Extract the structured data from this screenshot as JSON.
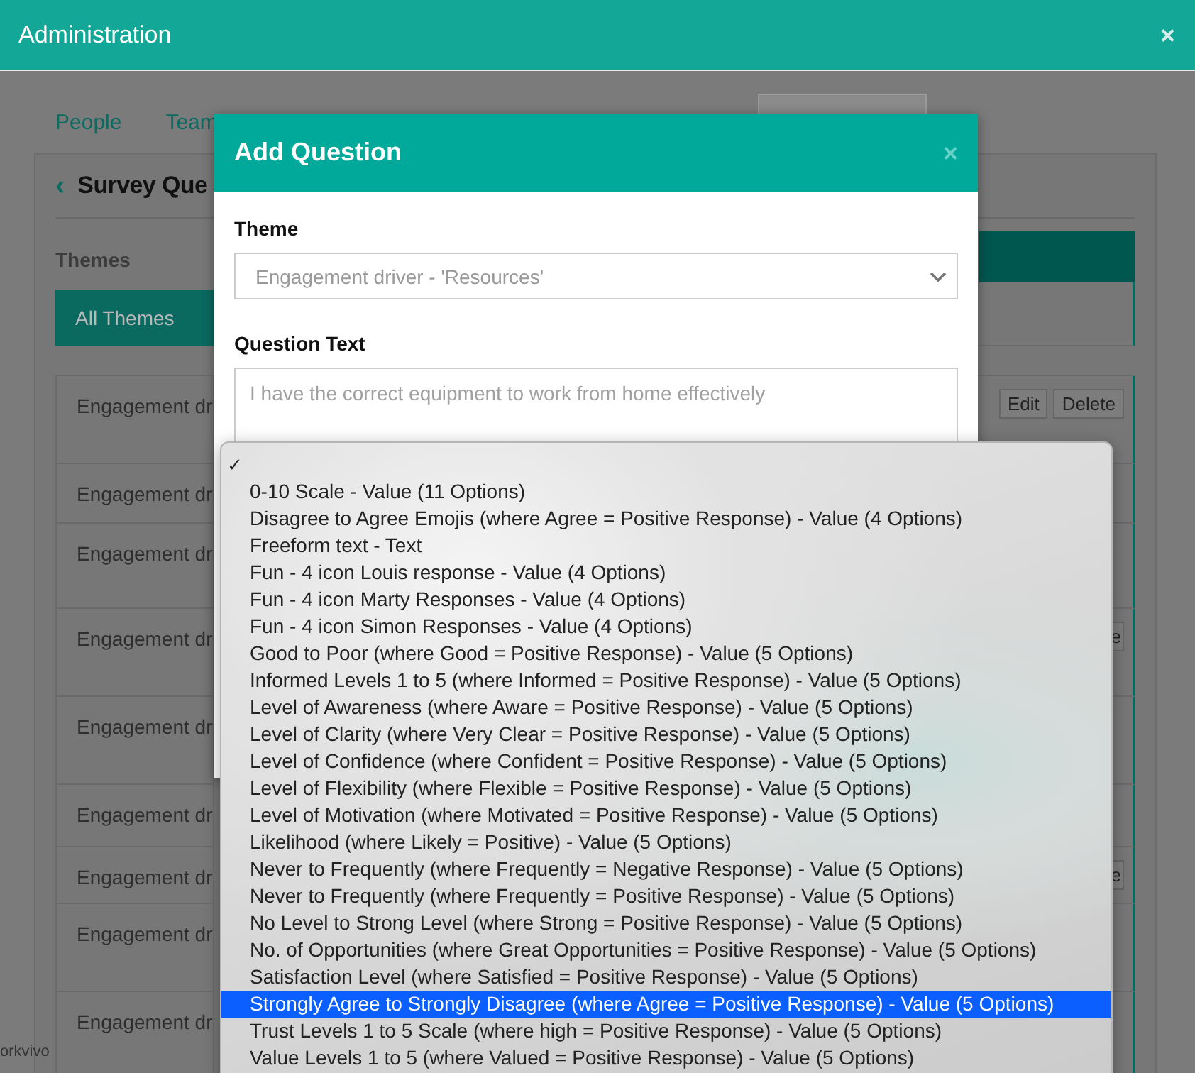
{
  "window": {
    "title": "Administration",
    "close": "×"
  },
  "tabs": [
    {
      "label": "People",
      "selected": false
    },
    {
      "label": "Team",
      "selected": false
    }
  ],
  "panel": {
    "back": "‹",
    "title": "Survey Que",
    "themes_label": "Themes",
    "all_themes": {
      "label": "All Themes",
      "selected": true
    }
  },
  "rows": [
    {
      "label": "Engagement dr",
      "actions": [
        "Edit",
        "Delete"
      ]
    },
    {
      "label": "Engagement dr",
      "actions": []
    },
    {
      "label": "Engagement dr",
      "actions": []
    },
    {
      "label": "Engagement dr",
      "actions": [
        "e"
      ]
    },
    {
      "label": "Engagement dr",
      "actions": []
    },
    {
      "label": "Engagement dr",
      "actions": []
    },
    {
      "label": "Engagement dr",
      "actions": [
        "e"
      ]
    },
    {
      "label": "Engagement dr",
      "actions": []
    },
    {
      "label": "Engagement dr",
      "actions": []
    }
  ],
  "footer": "orkvivo",
  "modal": {
    "title": "Add Question",
    "close": "×",
    "theme_label": "Theme",
    "theme_select": {
      "value": "Engagement driver - 'Resources'",
      "disabled": true
    },
    "question_label": "Question Text",
    "question_field": {
      "placeholder": "I have the correct equipment to work from home effectively"
    }
  },
  "menu": {
    "checkmark": "✓",
    "options": [
      {
        "label": "0-10 Scale - Value (11 Options)",
        "selected": false
      },
      {
        "label": "Disagree to Agree Emojis (where Agree = Positive Response) - Value (4 Options)",
        "selected": false
      },
      {
        "label": "Freeform text - Text",
        "selected": false
      },
      {
        "label": "Fun - 4 icon Louis response - Value (4 Options)",
        "selected": false
      },
      {
        "label": "Fun - 4 icon Marty Responses - Value (4 Options)",
        "selected": false
      },
      {
        "label": "Fun - 4 icon Simon Responses - Value (4 Options)",
        "selected": false
      },
      {
        "label": "Good to Poor (where Good = Positive Response) - Value (5 Options)",
        "selected": false
      },
      {
        "label": "Informed Levels 1 to 5 (where Informed = Positive Response) - Value (5 Options)",
        "selected": false
      },
      {
        "label": "Level of Awareness (where Aware = Positive Response) - Value (5 Options)",
        "selected": false
      },
      {
        "label": "Level of Clarity (where Very Clear = Positive Response) - Value (5 Options)",
        "selected": false
      },
      {
        "label": "Level of Confidence (where Confident = Positive Response) - Value (5 Options)",
        "selected": false
      },
      {
        "label": "Level of Flexibility (where Flexible = Positive Response) - Value (5 Options)",
        "selected": false
      },
      {
        "label": "Level of Motivation (where Motivated = Positive Response) - Value (5 Options)",
        "selected": false
      },
      {
        "label": "Likelihood (where Likely = Positive) - Value (5 Options)",
        "selected": false
      },
      {
        "label": "Never to Frequently (where Frequently = Negative Response) - Value (5 Options)",
        "selected": false
      },
      {
        "label": "Never to Frequently (where Frequently = Positive Response) - Value (5 Options)",
        "selected": false
      },
      {
        "label": "No Level to Strong Level (where Strong = Positive Response) - Value (5 Options)",
        "selected": false
      },
      {
        "label": "No. of Opportunities (where Great Opportunities = Positive Response) - Value (5 Options)",
        "selected": false
      },
      {
        "label": "Satisfaction Level (where Satisfied = Positive Response) - Value (5 Options)",
        "selected": false
      },
      {
        "label": "Strongly Agree to Strongly Disagree (where Agree = Positive Response) - Value (5 Options)",
        "selected": true
      },
      {
        "label": "Trust Levels 1 to 5 Scale (where high = Positive Response) - Value (5 Options)",
        "selected": false
      },
      {
        "label": "Value Levels 1 to 5 (where Valued = Positive Response) - Value (5 Options)",
        "selected": false
      }
    ]
  }
}
